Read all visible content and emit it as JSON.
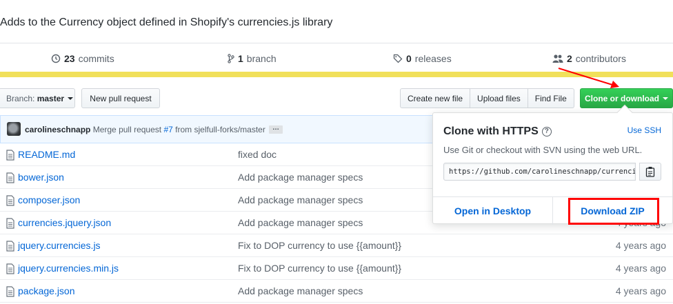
{
  "repo": {
    "description": "Adds to the Currency object defined in Shopify's currencies.js library"
  },
  "summary": {
    "commits_count": "23",
    "commits_label": "commits",
    "branches_count": "1",
    "branches_label": "branch",
    "releases_count": "0",
    "releases_label": "releases",
    "contributors_count": "2",
    "contributors_label": "contributors"
  },
  "toolbar": {
    "branch_prefix": "Branch:",
    "branch_name": "master",
    "new_pull_request": "New pull request",
    "create_new_file": "Create new file",
    "upload_files": "Upload files",
    "find_file": "Find File",
    "clone_or_download": "Clone or download"
  },
  "commit": {
    "author": "carolineschnapp",
    "message_prefix": "Merge pull request",
    "pr_link": "#7",
    "message_suffix": "from sjelfull-forks/master",
    "more": "…"
  },
  "files": [
    {
      "name": "README.md",
      "message": "fixed doc",
      "age": ""
    },
    {
      "name": "bower.json",
      "message": "Add package manager specs",
      "age": ""
    },
    {
      "name": "composer.json",
      "message": "Add package manager specs",
      "age": ""
    },
    {
      "name": "currencies.jquery.json",
      "message": "Add package manager specs",
      "age": "4 years ago"
    },
    {
      "name": "jquery.currencies.js",
      "message": "Fix to DOP currency to use {{amount}}",
      "age": "4 years ago"
    },
    {
      "name": "jquery.currencies.min.js",
      "message": "Fix to DOP currency to use {{amount}}",
      "age": "4 years ago"
    },
    {
      "name": "package.json",
      "message": "Add package manager specs",
      "age": "4 years ago"
    }
  ],
  "clone_popover": {
    "title": "Clone with HTTPS",
    "help_icon": "question-icon",
    "use_ssh": "Use SSH",
    "help_text": "Use Git or checkout with SVN using the web URL.",
    "url": "https://github.com/carolineschnapp/currencies.git",
    "copy_icon": "clipboard-icon",
    "open_in_desktop": "Open in Desktop",
    "download_zip": "Download ZIP"
  },
  "colors": {
    "link": "#0366d6",
    "clone_button": "#28a745",
    "language_bar": "#f1e05a",
    "annotation": "#ff0000"
  }
}
